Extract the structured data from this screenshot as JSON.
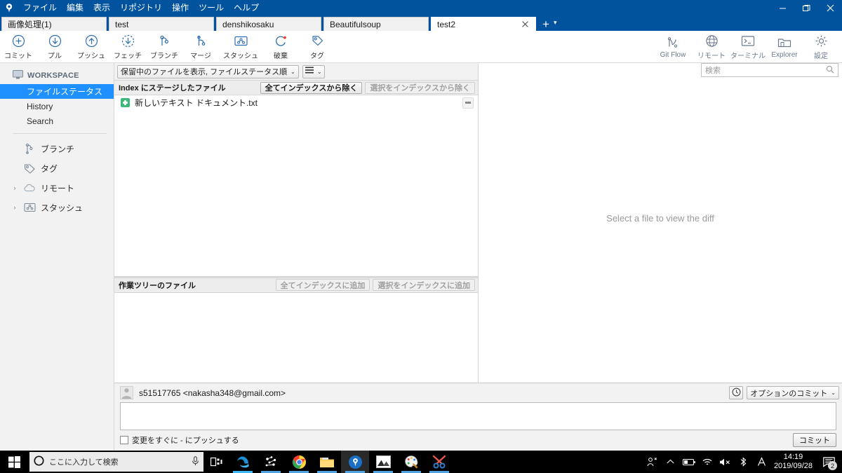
{
  "window": {
    "app_icon": "sourcetree-logo-icon",
    "menu": [
      "ファイル",
      "編集",
      "表示",
      "リポジトリ",
      "操作",
      "ツール",
      "ヘルプ"
    ],
    "minimize": "–",
    "restore": "❐",
    "close": "✕"
  },
  "tabs": [
    {
      "label": "画像処理(1)",
      "active": false
    },
    {
      "label": "test",
      "active": false
    },
    {
      "label": "denshikosaku",
      "active": false
    },
    {
      "label": "Beautifulsoup",
      "active": false
    },
    {
      "label": "test2",
      "active": true
    }
  ],
  "toolbar": {
    "left": [
      {
        "label": "コミット",
        "icon": "commit-plus-icon"
      },
      {
        "label": "プル",
        "icon": "pull-down-arrow-icon"
      },
      {
        "label": "プッシュ",
        "icon": "push-up-arrow-icon"
      },
      {
        "label": "フェッチ",
        "icon": "fetch-dashed-arrow-icon"
      },
      {
        "label": "ブランチ",
        "icon": "branch-icon"
      },
      {
        "label": "マージ",
        "icon": "merge-icon"
      },
      {
        "label": "スタッシュ",
        "icon": "stash-icon"
      },
      {
        "label": "破棄",
        "icon": "discard-refresh-icon"
      },
      {
        "label": "タグ",
        "icon": "tag-icon"
      }
    ],
    "right": [
      {
        "label": "Git Flow",
        "icon": "git-flow-icon"
      },
      {
        "label": "リモート",
        "icon": "remote-globe-icon"
      },
      {
        "label": "ターミナル",
        "icon": "terminal-icon"
      },
      {
        "label": "Explorer",
        "icon": "explorer-folder-icon"
      },
      {
        "label": "設定",
        "icon": "settings-gear-icon"
      }
    ]
  },
  "search": {
    "placeholder": "検索",
    "value": "検索",
    "icon": "search-icon"
  },
  "sidebar": {
    "workspace_label": "WORKSPACE",
    "workspace_icon": "monitor-icon",
    "items": [
      {
        "label": "ファイルステータス",
        "selected": true
      },
      {
        "label": "History",
        "selected": false
      },
      {
        "label": "Search",
        "selected": false
      }
    ],
    "sections": [
      {
        "label": "ブランチ",
        "icon": "branch-icon",
        "expandable": false
      },
      {
        "label": "タグ",
        "icon": "tag-icon",
        "expandable": false
      },
      {
        "label": "リモート",
        "icon": "cloud-icon",
        "expandable": true,
        "caret": "›"
      },
      {
        "label": "スタッシュ",
        "icon": "stash-icon",
        "expandable": true,
        "caret": "›"
      }
    ]
  },
  "filter": {
    "mode_label": "保留中のファイルを表示, ファイルステータス順",
    "view_icon": "list-view-icon",
    "chevron": "⌄"
  },
  "staged_panel": {
    "title": "Index にステージしたファイル",
    "unstage_all_label": "全てインデックスから除く",
    "unstage_selected_label": "選択をインデックスから除く",
    "unstage_selected_disabled": true,
    "files": [
      {
        "name": "新しいテキスト ドキュメント.txt",
        "status": "added",
        "status_color": "#3cb878",
        "row_action_icon": "minus-icon"
      }
    ]
  },
  "worktree_panel": {
    "title": "作業ツリーのファイル",
    "stage_all_label": "全てインデックスに追加",
    "stage_selected_label": "選択をインデックスに追加",
    "stage_all_disabled": true,
    "stage_selected_disabled": true,
    "files": []
  },
  "diff": {
    "empty_message": "Select a file to view the diff"
  },
  "commit": {
    "author": "s51517765 <nakasha348@gmail.com>",
    "avatar_icon": "user-avatar-icon",
    "history_icon": "clock-icon",
    "options_label": "オプションのコミット",
    "options_chevron": "⌄",
    "message_value": "",
    "push_checkbox_label": "変更をすぐに - にプッシュする",
    "push_checked": false,
    "commit_button_label": "コミット"
  },
  "taskbar": {
    "start_icon": "windows-start-icon",
    "search_placeholder": "ここに入力して検索",
    "cortana_icon": "cortana-circle-icon",
    "mic_icon": "microphone-icon",
    "taskview_icon": "task-view-icon",
    "apps": [
      {
        "icon": "edge-icon",
        "active": false
      },
      {
        "icon": "scatter-plot-app-icon",
        "active": false
      },
      {
        "icon": "chrome-icon",
        "active": false
      },
      {
        "icon": "file-explorer-icon",
        "active": false
      },
      {
        "icon": "sourcetree-icon",
        "active": true
      },
      {
        "icon": "photos-icon",
        "active": false
      },
      {
        "icon": "paint-icon",
        "active": false
      },
      {
        "icon": "snipping-tool-icon",
        "active": false
      }
    ],
    "tray": [
      {
        "icon": "people-icon"
      },
      {
        "icon": "show-hidden-chevron-icon"
      },
      {
        "icon": "battery-icon"
      },
      {
        "icon": "wifi-icon"
      },
      {
        "icon": "speaker-muted-icon"
      },
      {
        "icon": "bluetooth-icon"
      },
      {
        "icon": "ime-input-A-icon"
      }
    ],
    "time": "14:19",
    "date": "2019/09/28",
    "notification_count": "2",
    "notification_icon": "action-center-icon"
  },
  "colors": {
    "titlebar": "#00539c",
    "selection": "#1e90ff",
    "added_green": "#3cb878",
    "toolbar_blue": "#2f6fb0",
    "toolbar_gray": "#6b7a8d"
  }
}
